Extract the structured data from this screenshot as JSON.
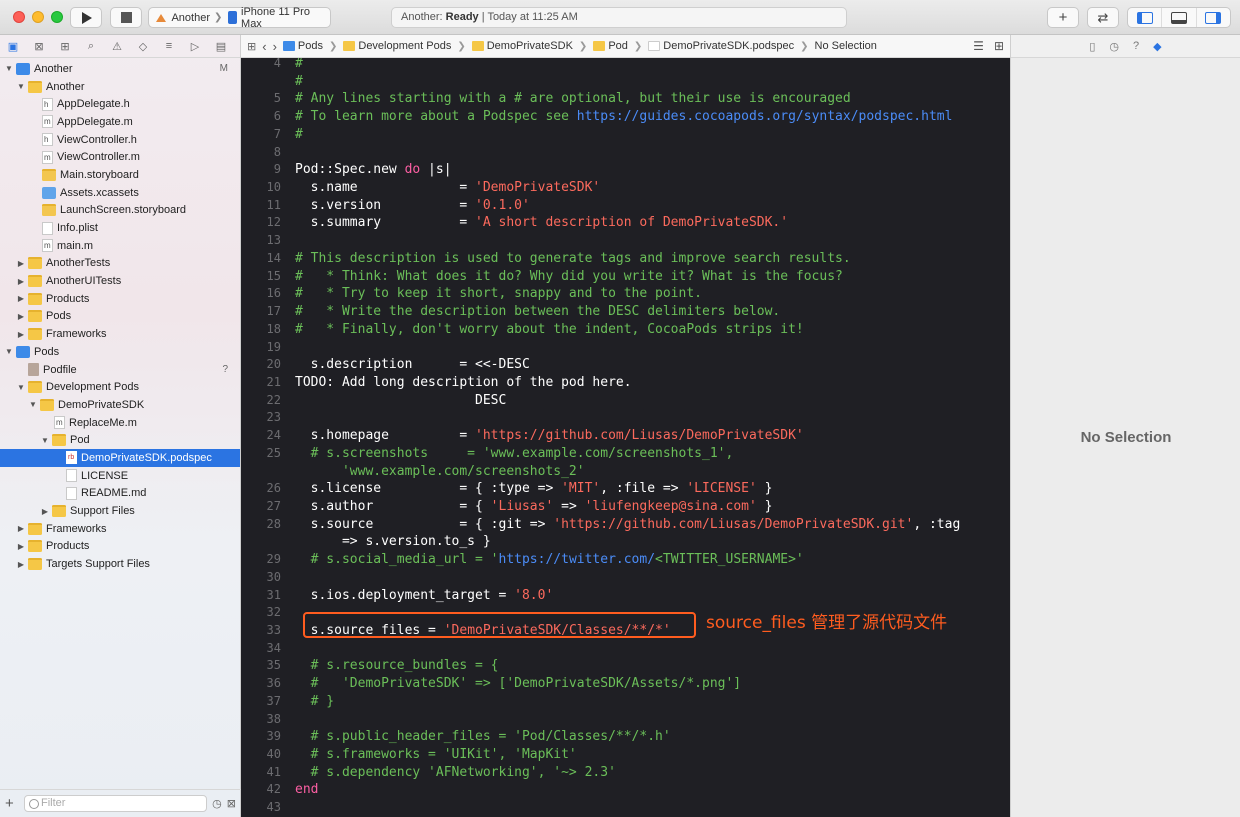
{
  "toolbar": {
    "scheme_project": "Another",
    "scheme_device": "iPhone 11 Pro Max",
    "status_app": "Another: ",
    "status_state": "Ready",
    "status_time": " | Today at 11:25 AM"
  },
  "navigator": {
    "tree": [
      {
        "label": "Another",
        "badge": "M"
      },
      {
        "label": "Another"
      },
      {
        "label": "AppDelegate.h"
      },
      {
        "label": "AppDelegate.m"
      },
      {
        "label": "ViewController.h"
      },
      {
        "label": "ViewController.m"
      },
      {
        "label": "Main.storyboard"
      },
      {
        "label": "Assets.xcassets"
      },
      {
        "label": "LaunchScreen.storyboard"
      },
      {
        "label": "Info.plist"
      },
      {
        "label": "main.m"
      },
      {
        "label": "AnotherTests"
      },
      {
        "label": "AnotherUITests"
      },
      {
        "label": "Products"
      },
      {
        "label": "Pods"
      },
      {
        "label": "Frameworks"
      },
      {
        "label": "Pods"
      },
      {
        "label": "Podfile",
        "badge": "?"
      },
      {
        "label": "Development Pods"
      },
      {
        "label": "DemoPrivateSDK"
      },
      {
        "label": "ReplaceMe.m"
      },
      {
        "label": "Pod"
      },
      {
        "label": "DemoPrivateSDK.podspec"
      },
      {
        "label": "LICENSE"
      },
      {
        "label": "README.md"
      },
      {
        "label": "Support Files"
      },
      {
        "label": "Frameworks"
      },
      {
        "label": "Products"
      },
      {
        "label": "Targets Support Files"
      }
    ],
    "filter_placeholder": "Filter"
  },
  "jumpbar": {
    "crumbs": [
      "Pods",
      "Development Pods",
      "DemoPrivateSDK",
      "Pod",
      "DemoPrivateSDK.podspec",
      "No Selection"
    ]
  },
  "editor": {
    "lines": [
      {
        "n": "4",
        "t": "# "
      },
      {
        "n": "",
        "t": "#"
      },
      {
        "n": "5",
        "t": "# Any lines starting with a # are optional, but their use is encouraged"
      },
      {
        "n": "6",
        "t": "# To learn more about a Podspec see ",
        "u": "https://guides.cocoapods.org/syntax/podspec.html"
      },
      {
        "n": "7",
        "t": "#"
      },
      {
        "n": "8",
        "t": ""
      },
      {
        "n": "9",
        "a": "Pod::Spec.new ",
        "k": "do",
        "b": " |s|"
      },
      {
        "n": "10",
        "a": "  s.name             = ",
        "s": "'DemoPrivateSDK'"
      },
      {
        "n": "11",
        "a": "  s.version          = ",
        "s": "'0.1.0'"
      },
      {
        "n": "12",
        "a": "  s.summary          = ",
        "s": "'A short description of DemoPrivateSDK.'"
      },
      {
        "n": "13",
        "t": ""
      },
      {
        "n": "14",
        "t": "# This description is used to generate tags and improve search results."
      },
      {
        "n": "15",
        "t": "#   * Think: What does it do? Why did you write it? What is the focus?"
      },
      {
        "n": "16",
        "t": "#   * Try to keep it short, snappy and to the point."
      },
      {
        "n": "17",
        "t": "#   * Write the description between the DESC delimiters below."
      },
      {
        "n": "18",
        "t": "#   * Finally, don't worry about the indent, CocoaPods strips it!"
      },
      {
        "n": "19",
        "t": ""
      },
      {
        "n": "20",
        "a": "  s.description      = <<-DESC"
      },
      {
        "n": "21",
        "a": "TODO: Add long description of the pod here."
      },
      {
        "n": "22",
        "a": "                       DESC"
      },
      {
        "n": "23",
        "t": ""
      },
      {
        "n": "24",
        "a": "  s.homepage         = ",
        "s": "'https://github.com/Liusas/DemoPrivateSDK'"
      },
      {
        "n": "25",
        "t": "  # s.screenshots     = 'www.example.com/screenshots_1',"
      },
      {
        "n": "",
        "t": "      'www.example.com/screenshots_2'"
      },
      {
        "n": "26",
        "a": "  s.license          = { :type => ",
        "s": "'MIT'",
        "b": ", :file => ",
        "s2": "'LICENSE'",
        "c": " }"
      },
      {
        "n": "27",
        "a": "  s.author           = { ",
        "s": "'Liusas'",
        "b": " => ",
        "s2": "'liufengkeep@sina.com'",
        "c": " }"
      },
      {
        "n": "28",
        "a": "  s.source           = { :git => ",
        "s": "'https://github.com/Liusas/DemoPrivateSDK.git'",
        "b": ", :tag"
      },
      {
        "n": "",
        "a": "      => s.version.to_s }"
      },
      {
        "n": "29",
        "t": "  # s.social_media_url = '",
        "u": "https://twitter.com/",
        "t2": "<TWITTER_USERNAME>'"
      },
      {
        "n": "30",
        "t": ""
      },
      {
        "n": "31",
        "a": "  s.ios.deployment_target = ",
        "s": "'8.0'"
      },
      {
        "n": "32",
        "t": ""
      },
      {
        "n": "33",
        "a": "  s.source_files = ",
        "s": "'DemoPrivateSDK/Classes/**/*'"
      },
      {
        "n": "34",
        "t": ""
      },
      {
        "n": "35",
        "t": "  # s.resource_bundles = {"
      },
      {
        "n": "36",
        "t": "  #   'DemoPrivateSDK' => ['DemoPrivateSDK/Assets/*.png']"
      },
      {
        "n": "37",
        "t": "  # }"
      },
      {
        "n": "38",
        "t": ""
      },
      {
        "n": "39",
        "t": "  # s.public_header_files = 'Pod/Classes/**/*.h'"
      },
      {
        "n": "40",
        "t": "  # s.frameworks = 'UIKit', 'MapKit'"
      },
      {
        "n": "41",
        "t": "  # s.dependency 'AFNetworking', '~> 2.3'"
      },
      {
        "n": "42",
        "a": "end",
        "kw_only": true
      },
      {
        "n": "43",
        "t": ""
      }
    ],
    "annotation": "source_files 管理了源代码文件"
  },
  "inspector": {
    "empty_label": "No Selection"
  }
}
